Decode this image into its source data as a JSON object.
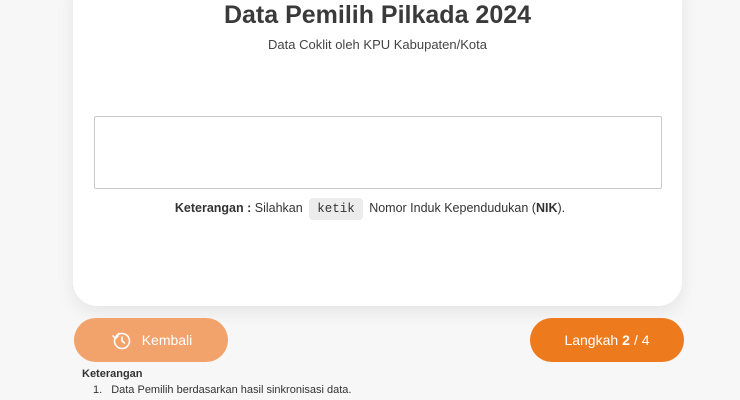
{
  "card": {
    "title": "Data Pemilih Pilkada 2024",
    "subtitle": "Data Coklit oleh KPU Kabupaten/Kota"
  },
  "nik_input": {
    "value": "",
    "placeholder": ""
  },
  "note": {
    "label": "Keterangan :",
    "text_before": "Silahkan",
    "key": "ketik",
    "text_middle": "Nomor Induk Kependudukan (",
    "nik": "NIK",
    "text_after": ")."
  },
  "buttons": {
    "back_label": "Kembali",
    "step_prefix": "Langkah",
    "step_current": "2",
    "step_separator": "/ 4"
  },
  "keterangan": {
    "heading": "Keterangan",
    "items": [
      {
        "num": "1.",
        "text": "Data Pemilih berdasarkan hasil sinkronisasi data."
      }
    ]
  },
  "colors": {
    "back_button": "#f2a36b",
    "step_button": "#ee7a1e"
  }
}
